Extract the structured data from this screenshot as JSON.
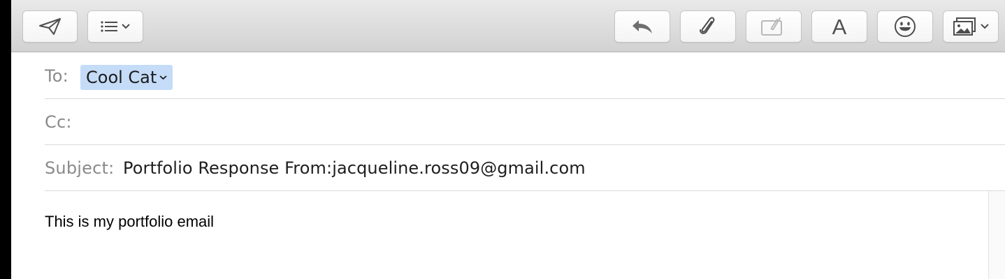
{
  "toolbar": {
    "send": {
      "icon": "paper-plane-icon"
    },
    "format_list": {
      "icon": "list-icon"
    },
    "reply": {
      "icon": "reply-arrow-icon"
    },
    "attach": {
      "icon": "paperclip-icon"
    },
    "markup": {
      "icon": "markup-icon"
    },
    "fonts": {
      "icon": "font-icon",
      "label": "A"
    },
    "emoji": {
      "icon": "emoji-icon"
    },
    "photo": {
      "icon": "photo-browser-icon"
    }
  },
  "to": {
    "label": "To:",
    "recipient": "Cool Cat"
  },
  "cc": {
    "label": "Cc:",
    "value": ""
  },
  "subject": {
    "label": "Subject:",
    "value": "Portfolio Response From:jacqueline.ross09@gmail.com"
  },
  "body": {
    "text": "This is my portfolio email"
  },
  "colors": {
    "token_background": "#c5dcf8",
    "toolbar_background": "#dcdcdc",
    "label_gray": "#8a8a8a"
  }
}
